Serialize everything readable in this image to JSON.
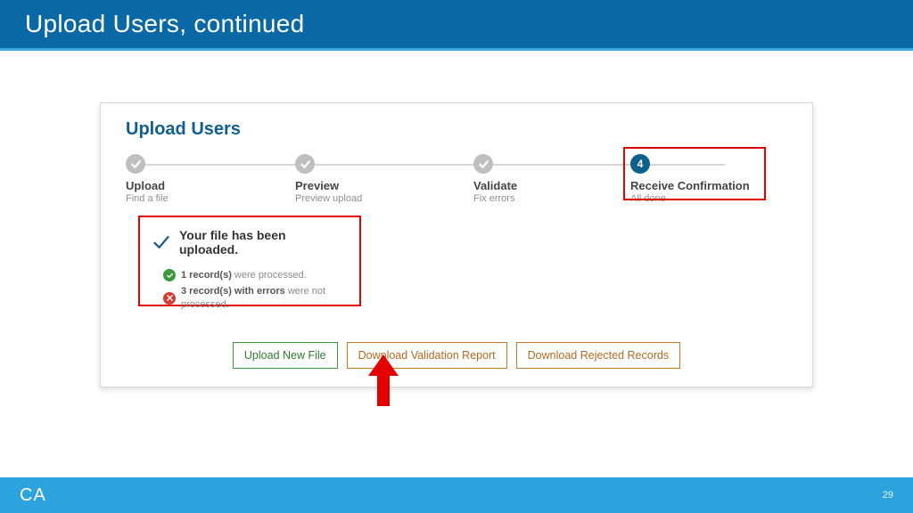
{
  "slide": {
    "title": "Upload Users, continued",
    "page_number": "29",
    "logo_text": "CA"
  },
  "panel": {
    "title": "Upload Users"
  },
  "steps": [
    {
      "label": "Upload",
      "sub": "Find a file"
    },
    {
      "label": "Preview",
      "sub": "Preview upload"
    },
    {
      "label": "Validate",
      "sub": "Fix errors"
    },
    {
      "label": "Receive Confirmation",
      "sub": "All done",
      "num": "4"
    }
  ],
  "result": {
    "headline": "Your file has been uploaded.",
    "ok_bold": "1 record(s)",
    "ok_rest": " were processed.",
    "err_bold": "3 record(s) with errors",
    "err_rest": " were not processed."
  },
  "buttons": {
    "upload_new": "Upload New File",
    "download_validation": "Download Validation Report",
    "download_rejected": "Download Rejected Records"
  }
}
